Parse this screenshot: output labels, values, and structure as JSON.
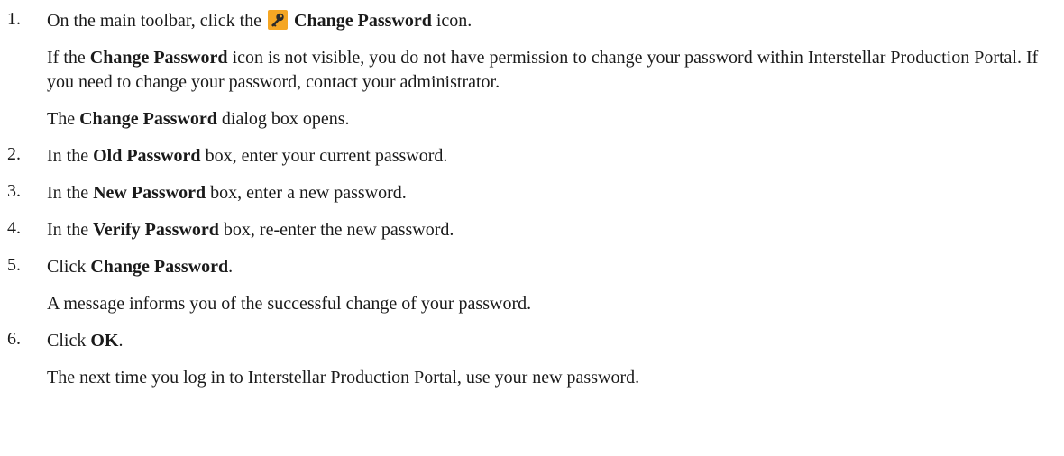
{
  "steps": [
    {
      "num": "1.",
      "line": {
        "pre": "On the main toolbar, click the",
        "icon": "key-icon",
        "bold": "Change Password",
        "post": "icon."
      },
      "note": {
        "pre": "If the",
        "bold": "Change Password",
        "post": "icon is not visible, you do not have permission to change your password within Interstellar Production Portal. If you need to change your password, contact your administrator."
      },
      "result": {
        "pre": "The",
        "bold": "Change Password",
        "post": "dialog box opens."
      }
    },
    {
      "num": "2.",
      "line": {
        "pre": "In the",
        "bold": "Old Password",
        "post": "box, enter your current password."
      }
    },
    {
      "num": "3.",
      "line": {
        "pre": "In the",
        "bold": "New Password",
        "post": "box, enter a new password."
      }
    },
    {
      "num": "4.",
      "line": {
        "pre": "In the",
        "bold": "Verify Password",
        "post": "box, re-enter the new password."
      }
    },
    {
      "num": "5.",
      "line": {
        "pre": "Click",
        "bold": "Change Password",
        "post": "."
      },
      "result": {
        "text": "A message informs you of the successful change of your password."
      }
    },
    {
      "num": "6.",
      "line": {
        "pre": "Click",
        "bold": "OK",
        "post": "."
      },
      "result": {
        "text": "The next time you log in to Interstellar Production Portal, use your new password."
      }
    }
  ],
  "colors": {
    "icon_background": "#f5a623",
    "icon_key": "#2b2b2b",
    "text": "#1a1a1a"
  }
}
